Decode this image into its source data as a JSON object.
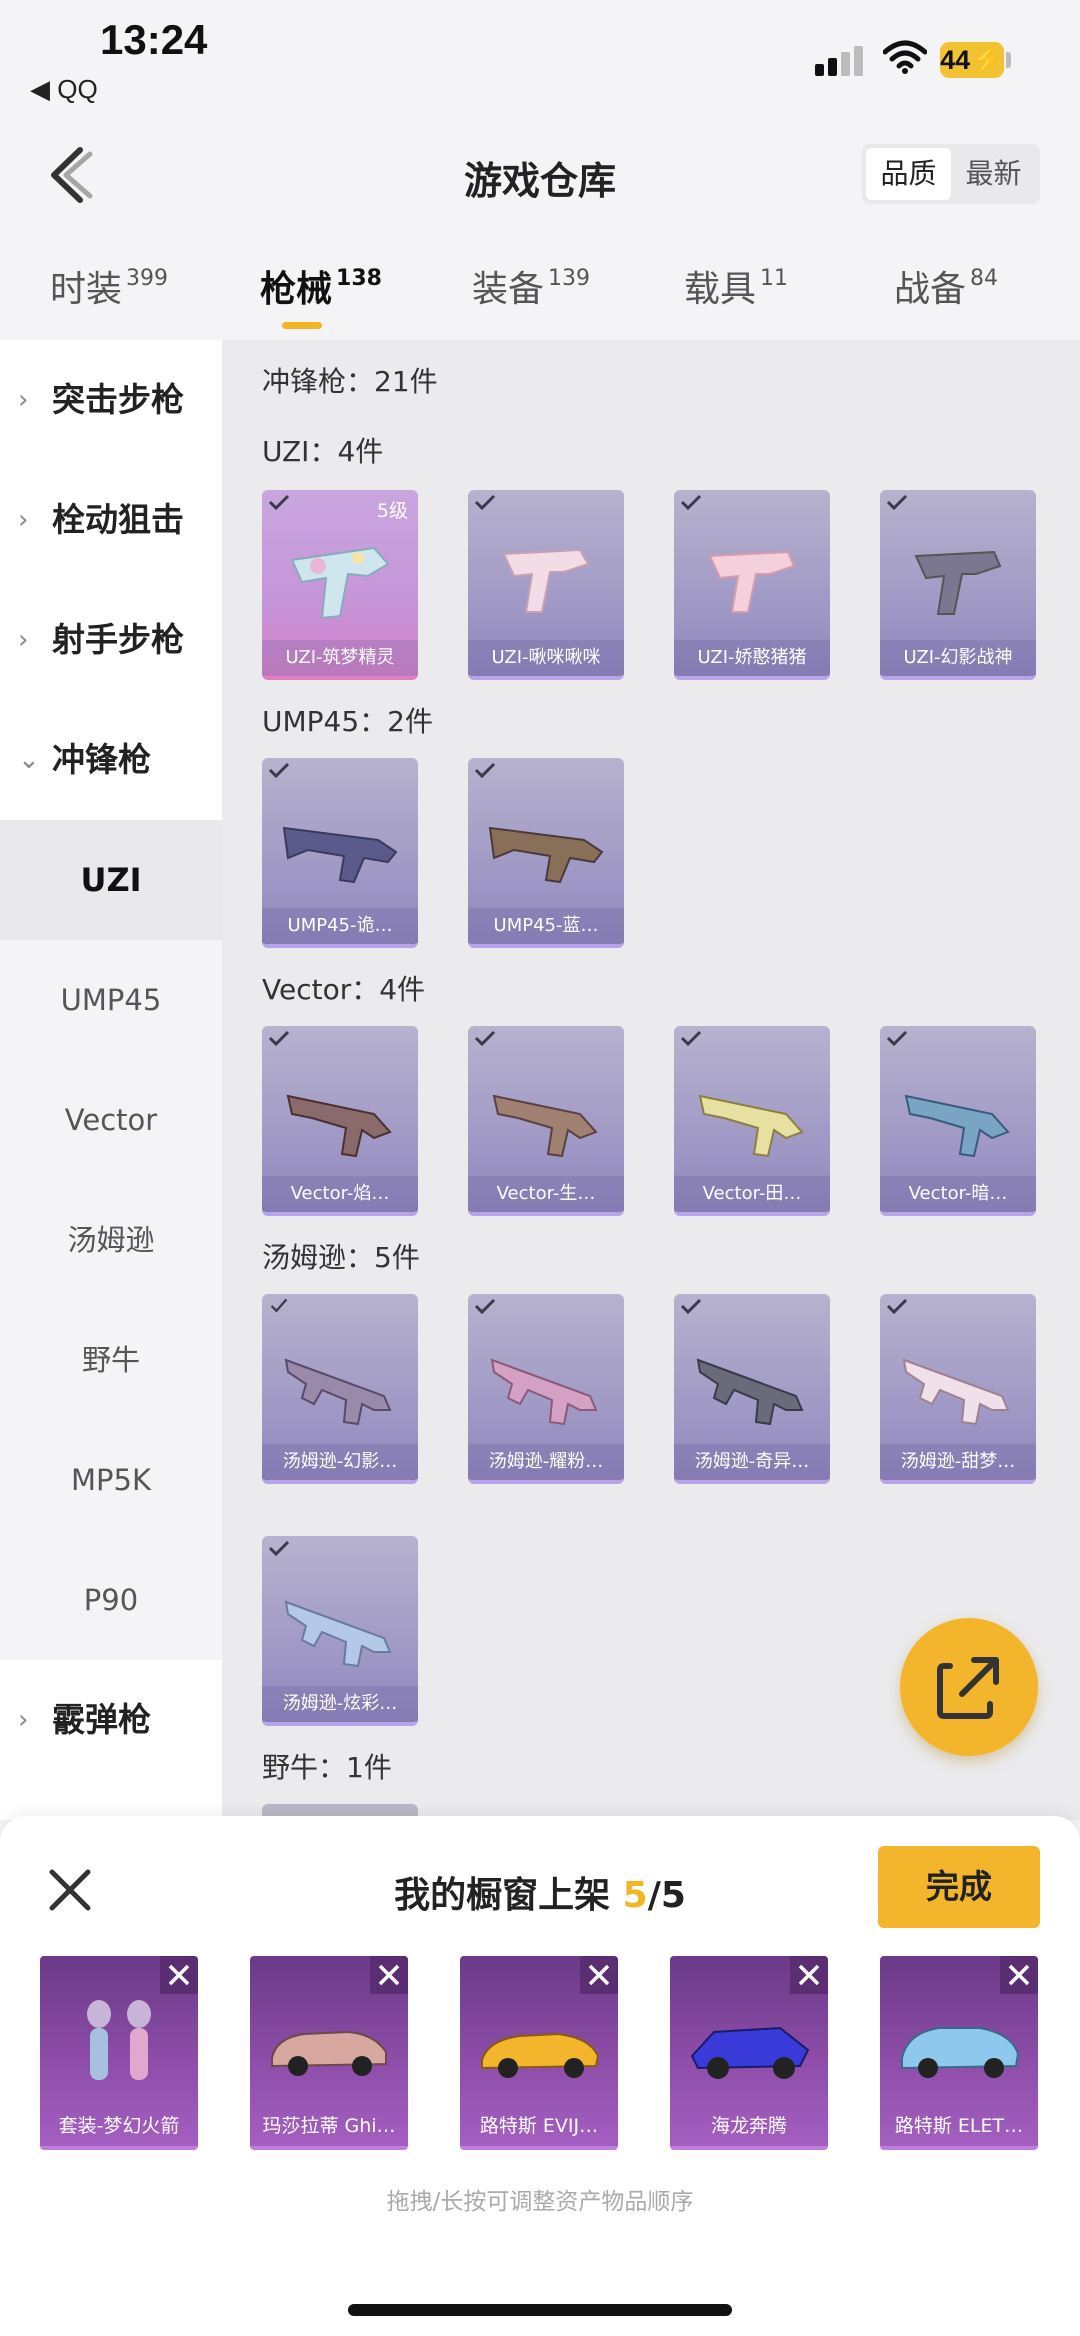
{
  "status_bar": {
    "time": "13:24",
    "back_app": "◀ QQ",
    "battery": "44"
  },
  "header": {
    "title": "游戏仓库",
    "sort_options": [
      {
        "label": "品质",
        "active": true
      },
      {
        "label": "最新",
        "active": false
      }
    ]
  },
  "tabs": [
    {
      "label": "时装",
      "count": "399",
      "active": false
    },
    {
      "label": "枪械",
      "count": "138",
      "active": true
    },
    {
      "label": "装备",
      "count": "139",
      "active": false
    },
    {
      "label": "载具",
      "count": "11",
      "active": false
    },
    {
      "label": "战备",
      "count": "84",
      "active": false
    }
  ],
  "sidebar": {
    "categories": [
      {
        "label": "突击步枪",
        "expanded": false
      },
      {
        "label": "栓动狙击",
        "expanded": false
      },
      {
        "label": "射手步枪",
        "expanded": false
      },
      {
        "label": "冲锋枪",
        "expanded": true
      },
      {
        "label": "霰弹枪",
        "expanded": false
      }
    ],
    "subitems": [
      {
        "label": "UZI",
        "selected": true
      },
      {
        "label": "UMP45",
        "selected": false
      },
      {
        "label": "Vector",
        "selected": false
      },
      {
        "label": "汤姆逊",
        "selected": false
      },
      {
        "label": "野牛",
        "selected": false
      },
      {
        "label": "MP5K",
        "selected": false
      },
      {
        "label": "P90",
        "selected": false
      }
    ]
  },
  "content": {
    "section_label": "冲锋枪：21件",
    "groups": [
      {
        "label": "UZI：4件",
        "items": [
          {
            "name": "UZI-筑梦精灵",
            "level": "5级",
            "rarity": "legendary"
          },
          {
            "name": "UZI-啾咪啾咪",
            "rarity": "epic"
          },
          {
            "name": "UZI-娇憨猪猪",
            "rarity": "epic"
          },
          {
            "name": "UZI-幻影战神",
            "rarity": "epic"
          }
        ]
      },
      {
        "label": "UMP45：2件",
        "items": [
          {
            "name": "UMP45-诡…",
            "rarity": "epic"
          },
          {
            "name": "UMP45-蓝…",
            "rarity": "epic"
          }
        ]
      },
      {
        "label": "Vector：4件",
        "items": [
          {
            "name": "Vector-焰…",
            "rarity": "epic"
          },
          {
            "name": "Vector-生…",
            "rarity": "epic"
          },
          {
            "name": "Vector-田…",
            "rarity": "epic"
          },
          {
            "name": "Vector-暗…",
            "rarity": "epic"
          }
        ]
      },
      {
        "label": "汤姆逊：5件",
        "items": [
          {
            "name": "汤姆逊-幻影…",
            "rarity": "epic"
          },
          {
            "name": "汤姆逊-耀粉…",
            "rarity": "epic"
          },
          {
            "name": "汤姆逊-奇异…",
            "rarity": "epic"
          },
          {
            "name": "汤姆逊-甜梦…",
            "rarity": "epic"
          },
          {
            "name": "汤姆逊-炫彩…",
            "rarity": "epic"
          }
        ]
      },
      {
        "label": "野牛：1件",
        "items": []
      }
    ]
  },
  "showcase": {
    "title": "我的橱窗上架",
    "count_current": "5",
    "count_total": "/5",
    "done_label": "完成",
    "items": [
      {
        "name": "套装-梦幻火箭"
      },
      {
        "name": "玛莎拉蒂 Ghi…"
      },
      {
        "name": "路特斯 EVIJ…"
      },
      {
        "name": "海龙奔腾"
      },
      {
        "name": "路特斯 ELET…"
      }
    ],
    "hint": "拖拽/长按可调整资产物品顺序"
  },
  "colors": {
    "accent": "#f3b52b",
    "legendary": "#d883c9",
    "epic": "#9d95c4",
    "showcase": "#8d4da8"
  },
  "icons": [
    "back-arrow-icon",
    "check-icon",
    "share-icon",
    "close-icon",
    "signal-icon",
    "wifi-icon"
  ]
}
